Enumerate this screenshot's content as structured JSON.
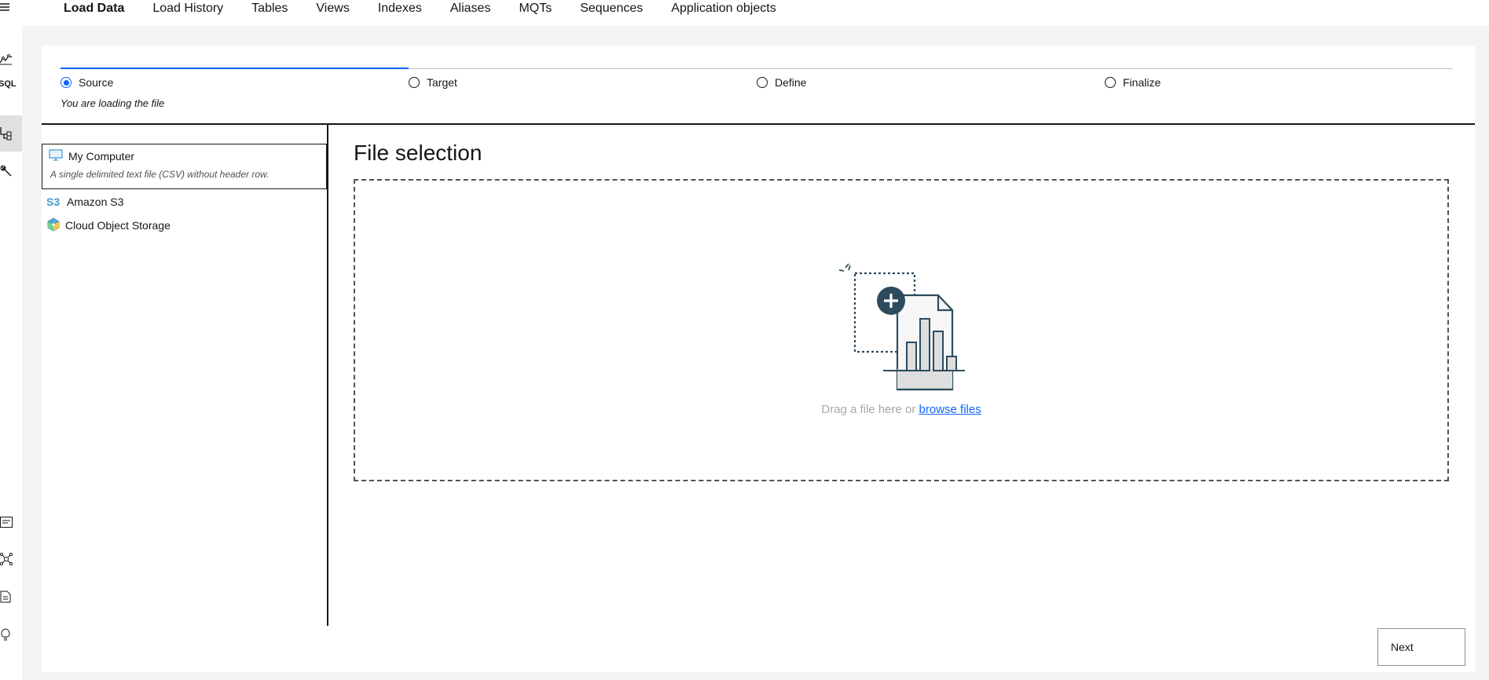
{
  "tabs": [
    {
      "label": "Load Data",
      "active": true
    },
    {
      "label": "Load History"
    },
    {
      "label": "Tables"
    },
    {
      "label": "Views"
    },
    {
      "label": "Indexes"
    },
    {
      "label": "Aliases"
    },
    {
      "label": "MQTs"
    },
    {
      "label": "Sequences"
    },
    {
      "label": "Application objects"
    }
  ],
  "rail": {
    "menu_icon": "hamburger-icon",
    "icons": [
      "chart-icon",
      "sql-icon",
      "data-tree-icon",
      "wrench-icon",
      "list-icon",
      "network-icon",
      "document-icon",
      "lightbulb-icon"
    ],
    "sql_text": "SQL"
  },
  "steps": [
    {
      "label": "Source",
      "checked": true
    },
    {
      "label": "Target",
      "checked": false
    },
    {
      "label": "Define",
      "checked": false
    },
    {
      "label": "Finalize",
      "checked": false
    }
  ],
  "step_description": "You are loading the file",
  "sources": {
    "my_computer": {
      "label": "My Computer",
      "description": "A single delimited text file (CSV) without header row.",
      "icon": "monitor-icon"
    },
    "amazon_s3": {
      "label": "Amazon S3",
      "badge": "S3"
    },
    "cloud_object_storage": {
      "label": "Cloud Object Storage",
      "icon": "cube-icon"
    }
  },
  "file_selection": {
    "title": "File selection",
    "drop_text": "Drag a file here or",
    "browse_link": "browse files",
    "illustration_icon": "file-upload-chart-icon"
  },
  "next_button": "Next",
  "colors": {
    "accent": "#0f62fe",
    "illustration": "#2d4b5e",
    "s3_badge": "#4a9bd1"
  }
}
